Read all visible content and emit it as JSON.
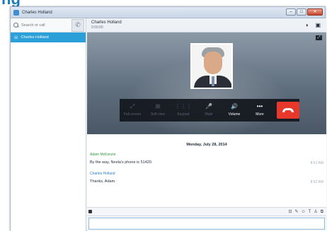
{
  "window": {
    "title": "Charles Holland"
  },
  "sidebar": {
    "search_placeholder": "Search or call",
    "contacts": [
      {
        "name": "Charles Holland",
        "selected": true
      }
    ]
  },
  "call": {
    "name": "Charles Holland",
    "duration": "0:00:00",
    "controls": [
      {
        "label": "Full screen",
        "icon": "fullscreen-icon",
        "glyph": "⤢",
        "enabled": false
      },
      {
        "label": "Self-view",
        "icon": "selfview-icon",
        "glyph": "⊞",
        "enabled": false
      },
      {
        "label": "Keypad",
        "icon": "keypad-icon",
        "glyph": "⋮⋮⋮",
        "enabled": false
      },
      {
        "label": "Mute",
        "icon": "mic-icon",
        "glyph": "🎤",
        "enabled": false
      },
      {
        "label": "Volume",
        "icon": "speaker-icon",
        "glyph": "🔊",
        "enabled": true
      },
      {
        "label": "More",
        "icon": "more-icon",
        "glyph": "•••",
        "enabled": true
      }
    ],
    "end_call_color": "#e8382b"
  },
  "chat": {
    "date": "Monday, July 28, 2014",
    "messages": [
      {
        "author": "Adam McKenzie",
        "author_color": "#2e9a3a",
        "text": "By the way, Neela's phone is 51420.",
        "time": "8:51 AM"
      },
      {
        "author": "Charles Holland",
        "author_color": "#2a7fc9",
        "text": "Thanks, Adam.",
        "time": "8:52 AM"
      }
    ]
  },
  "accent_color": "#2a9fd8"
}
